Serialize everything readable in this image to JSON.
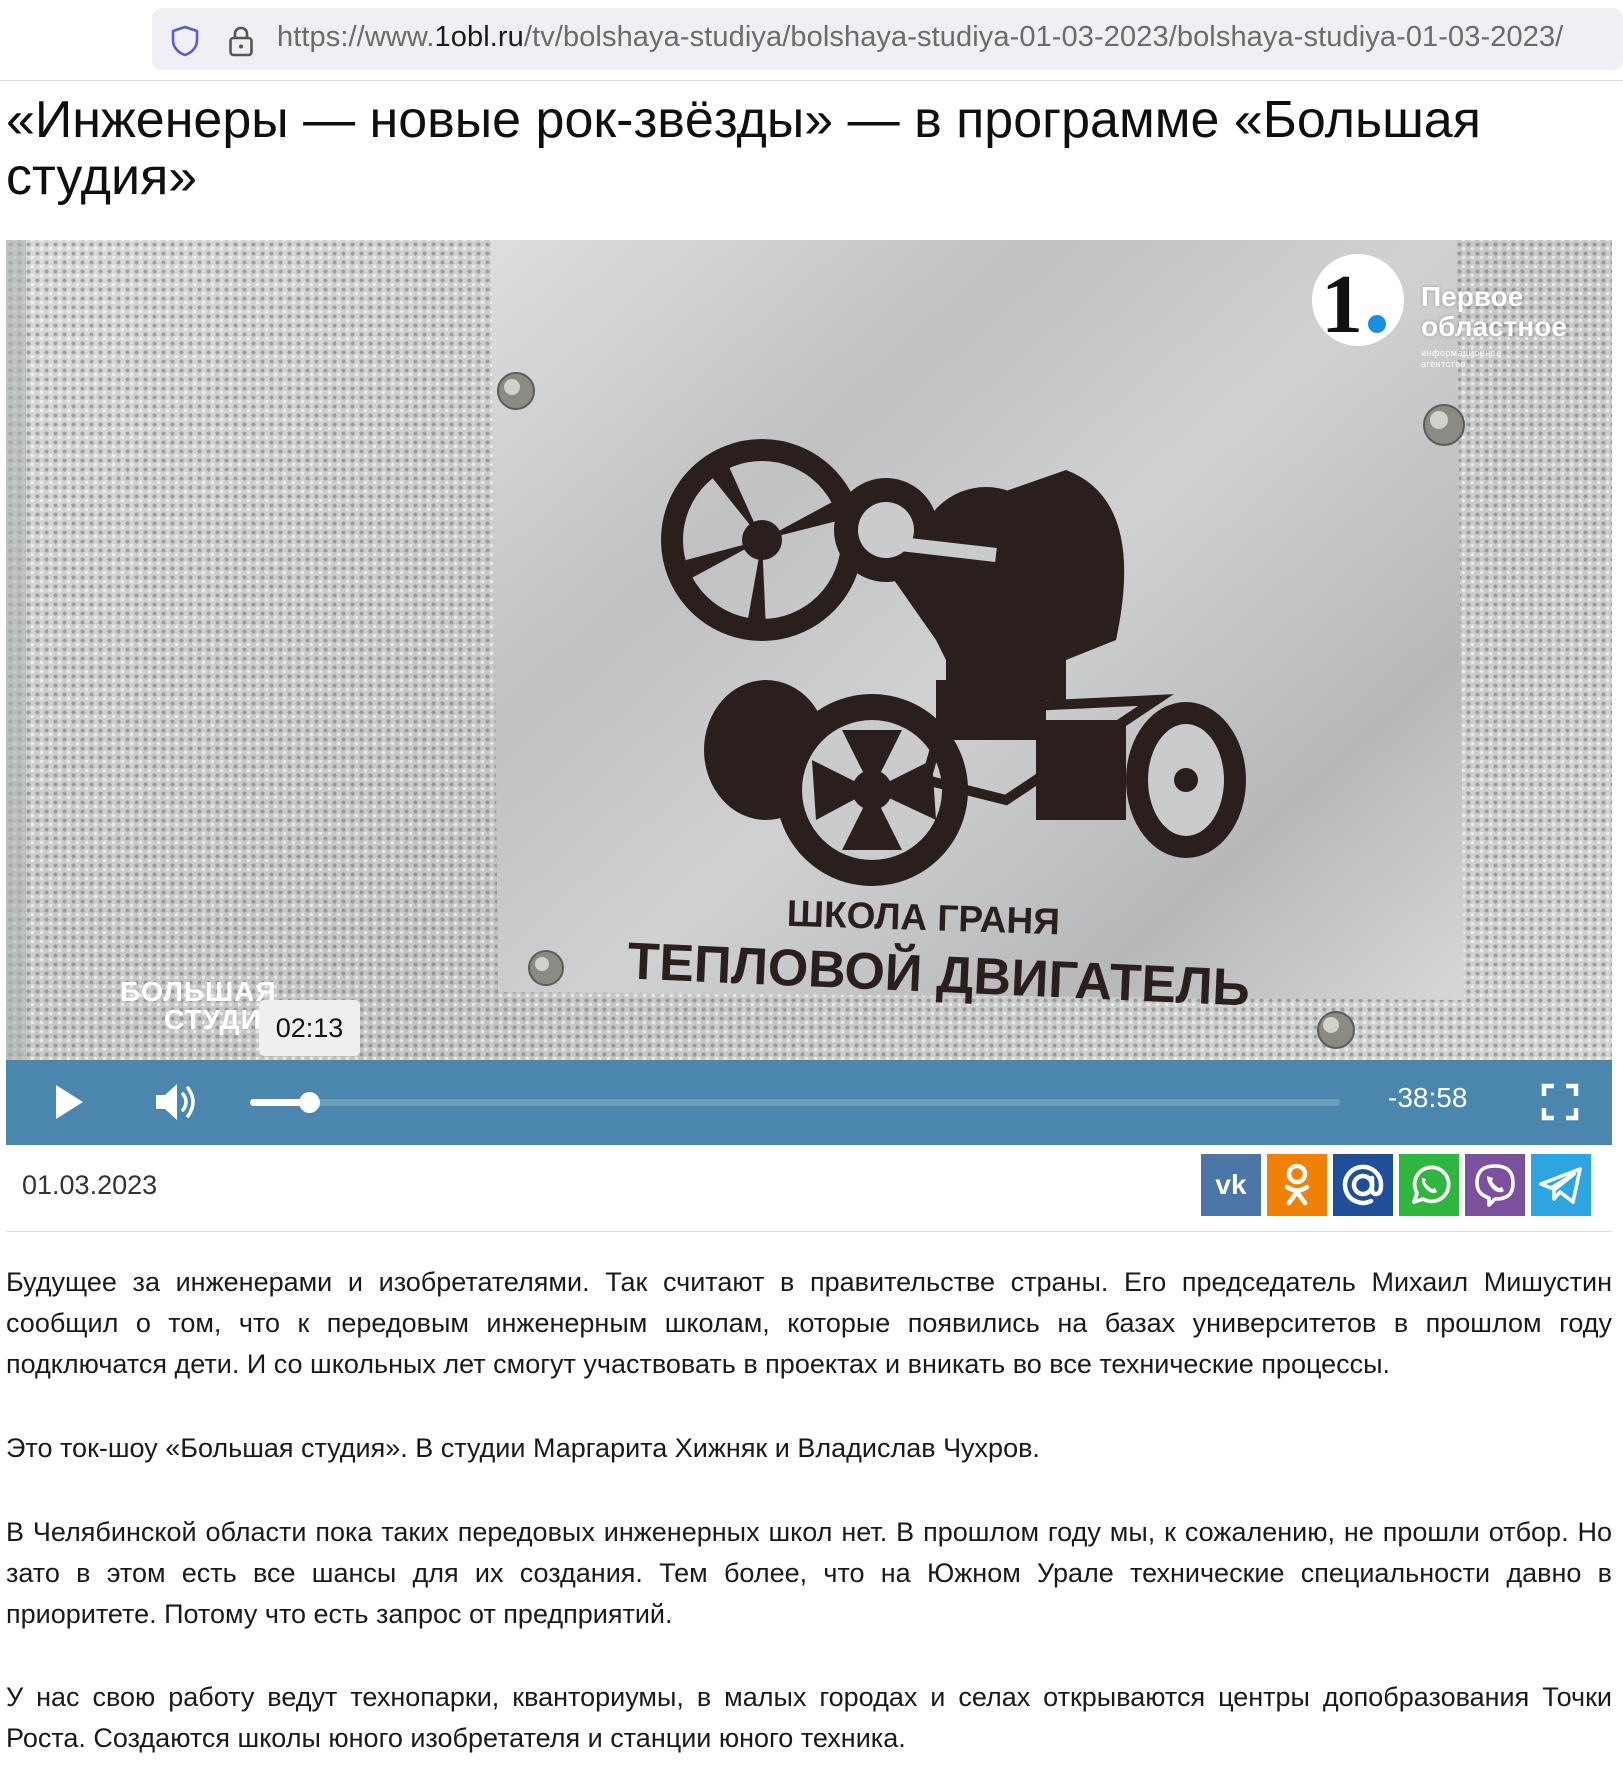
{
  "browser": {
    "url_prefix": "https://www.",
    "url_host": "1obl.ru",
    "url_path": "/tv/bolshaya-studiya/bolshaya-studiya-01-03-2023/bolshaya-studiya-01-03-2023/"
  },
  "article": {
    "title": "«Инженеры — новые рок-звёзды» — в программе «Большая студия»",
    "date": "01.03.2023",
    "paragraphs": [
      "Будущее за инженерами и изобретателями. Так считают в правительстве страны. Его председатель Михаил Мишустин сообщил о том, что к передовым инженерным школам, которые появились на базах университетов в прошлом году подключатся дети. И со школьных лет смогут участвовать в проектах и вникать во все технические процессы.",
      "Это ток-шоу «Большая студия». В студии Маргарита Хижняк и Владислав Чухров.",
      "В Челябинской области пока таких передовых инженерных школ нет. В прошлом году мы, к сожалению, не прошли отбор. Но зато в этом есть все шансы для их создания. Тем более, что на Южном Урале технические специальности давно в приоритете. Потому что есть запрос от предприятий.",
      "У нас свою работу ведут технопарки, кванториумы, в малых городах и селах открываются центры допобразования Точки Роста. Создаются школы юного изобретателя и станции юного техника."
    ]
  },
  "video": {
    "plaque_line1": "ШКОЛА ГРАНЯ",
    "plaque_line2": "ТЕПЛОВОЙ ДВИГАТЕЛЬ",
    "channel_logo_line1": "Первое",
    "channel_logo_line2": "областное",
    "channel_logo_sub": "информационное агентство",
    "show_logo_line1": "БОЛЬШАЯ",
    "show_logo_line2": "СТУДИ",
    "hover_time": "02:13",
    "time_remaining": "-38:58",
    "progress_fraction": 0.054,
    "controls_color": "#4a86ad"
  },
  "share": {
    "buttons": [
      {
        "name": "vk",
        "icon": "vk-icon",
        "color": "#4a76a8"
      },
      {
        "name": "odnoklassniki",
        "icon": "odnoklassniki-icon",
        "color": "#ee8208"
      },
      {
        "name": "mail",
        "icon": "mail-at-icon",
        "color": "#168de2"
      },
      {
        "name": "whatsapp",
        "icon": "whatsapp-icon",
        "color": "#2fb63f"
      },
      {
        "name": "viber",
        "icon": "viber-icon",
        "color": "#7b519d"
      },
      {
        "name": "telegram",
        "icon": "telegram-icon",
        "color": "#2ca5e0"
      }
    ]
  }
}
